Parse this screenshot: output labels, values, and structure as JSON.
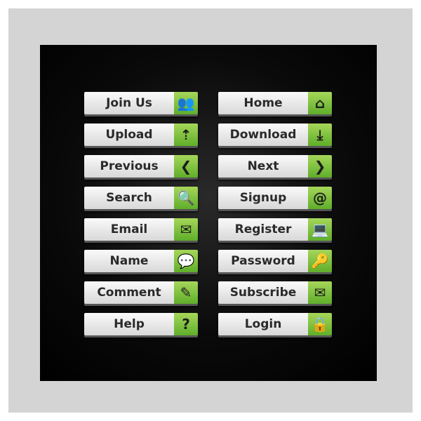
{
  "accent_color": "#6cba2e",
  "buttons": [
    {
      "label": "Join Us",
      "icon": "users-icon",
      "glyph": "👥"
    },
    {
      "label": "Home",
      "icon": "home-icon",
      "glyph": "⌂"
    },
    {
      "label": "Upload",
      "icon": "upload-icon",
      "glyph": "⇡"
    },
    {
      "label": "Download",
      "icon": "download-icon",
      "glyph": "⤓"
    },
    {
      "label": "Previous",
      "icon": "chevron-left-icon",
      "glyph": "❮"
    },
    {
      "label": "Next",
      "icon": "chevron-right-icon",
      "glyph": "❯"
    },
    {
      "label": "Search",
      "icon": "search-document-icon",
      "glyph": "🔍"
    },
    {
      "label": "Signup",
      "icon": "at-sign-icon",
      "glyph": "@"
    },
    {
      "label": "Email",
      "icon": "envelope-icon",
      "glyph": "✉"
    },
    {
      "label": "Register",
      "icon": "laptop-icon",
      "glyph": "💻"
    },
    {
      "label": "Name",
      "icon": "chat-bubble-icon",
      "glyph": "💬"
    },
    {
      "label": "Password",
      "icon": "key-icon",
      "glyph": "🔑"
    },
    {
      "label": "Comment",
      "icon": "document-pen-icon",
      "glyph": "✎"
    },
    {
      "label": "Subscribe",
      "icon": "envelope-cursor-icon",
      "glyph": "✉"
    },
    {
      "label": "Help",
      "icon": "question-icon",
      "glyph": "?"
    },
    {
      "label": "Login",
      "icon": "lock-icon",
      "glyph": "🔒"
    }
  ]
}
